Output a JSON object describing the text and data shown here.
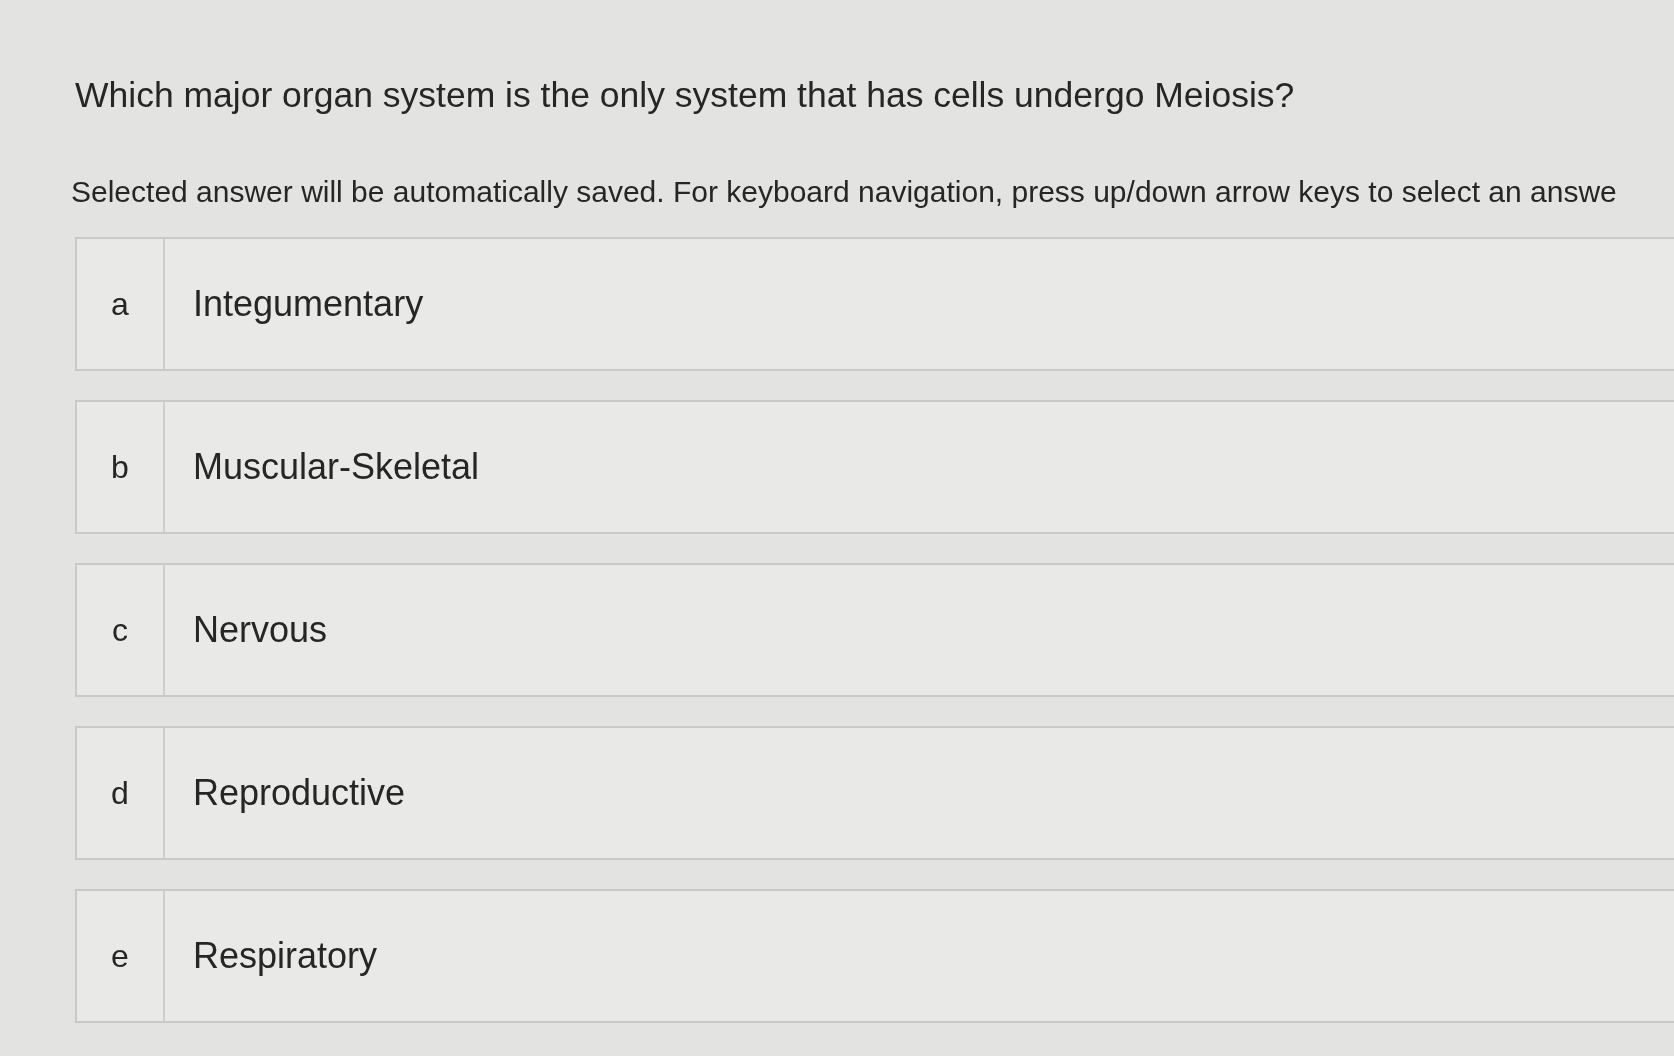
{
  "question": "Which major organ system is the only system that has cells undergo Meiosis?",
  "instructions": "Selected answer will be automatically saved. For keyboard navigation, press up/down arrow keys to select an answe",
  "options": [
    {
      "letter": "a",
      "label": "Integumentary",
      "selected": false
    },
    {
      "letter": "b",
      "label": "Muscular-Skeletal",
      "selected": false
    },
    {
      "letter": "c",
      "label": "Nervous",
      "selected": false
    },
    {
      "letter": "d",
      "label": "Reproductive",
      "selected": false
    },
    {
      "letter": "e",
      "label": "Respiratory",
      "selected": false
    }
  ]
}
